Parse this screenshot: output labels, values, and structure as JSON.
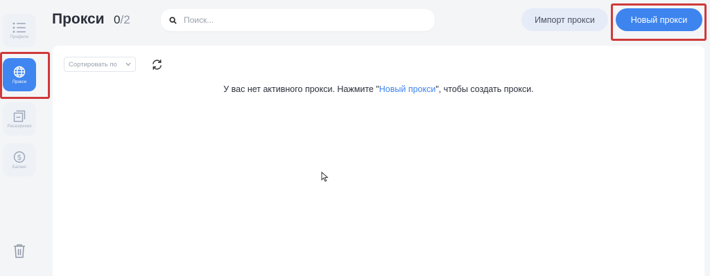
{
  "sidebar": {
    "items": [
      {
        "label": "Профили",
        "icon": "list-icon"
      },
      {
        "label": "Прокси",
        "icon": "globe-icon"
      },
      {
        "label": "Расширения",
        "icon": "extensions-icon"
      },
      {
        "label": "Баланс",
        "icon": "dollar-icon"
      }
    ],
    "trash_icon": "trash-icon"
  },
  "header": {
    "title": "Прокси",
    "count_current": "0",
    "count_max": "/2"
  },
  "search": {
    "placeholder": "Поиск..."
  },
  "buttons": {
    "import": "Импорт прокси",
    "new": "Новый прокси"
  },
  "toolbar": {
    "sort_label": "Сортировать по"
  },
  "empty": {
    "before": "У вас нет активного прокси. Нажмите \"",
    "link": "Новый прокси",
    "after": "\", чтобы создать прокси."
  },
  "colors": {
    "accent": "#3d84ef",
    "highlight": "#d0393a"
  }
}
